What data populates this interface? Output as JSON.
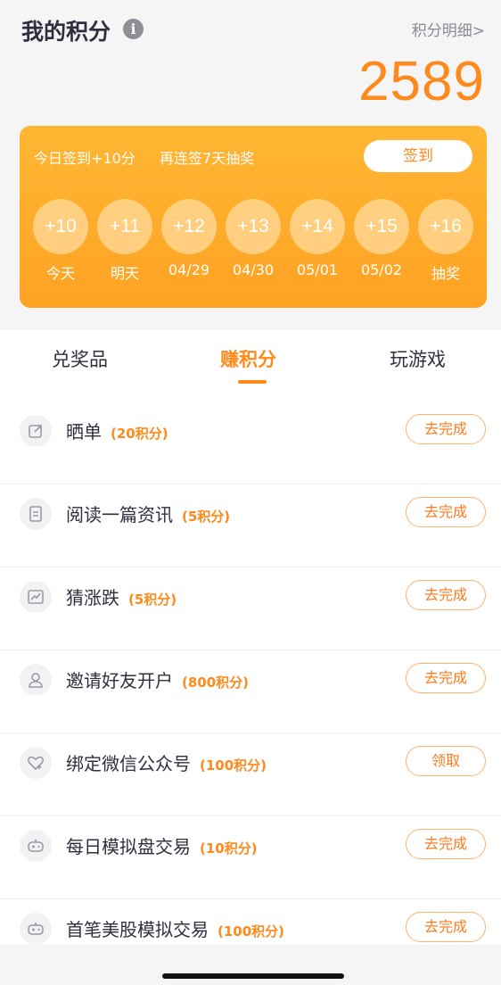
{
  "header": {
    "title": "我的积分",
    "detail_link": "积分明细>",
    "points": "2589"
  },
  "checkin": {
    "today_text": "今日签到+10分",
    "streak_text": "再连签7天抽奖",
    "button_label": "签到",
    "days": [
      {
        "bonus": "+10",
        "label": "今天"
      },
      {
        "bonus": "+11",
        "label": "明天"
      },
      {
        "bonus": "+12",
        "label": "04/29"
      },
      {
        "bonus": "+13",
        "label": "04/30"
      },
      {
        "bonus": "+14",
        "label": "05/01"
      },
      {
        "bonus": "+15",
        "label": "05/02"
      },
      {
        "bonus": "+16",
        "label": "抽奖"
      }
    ]
  },
  "tabs": [
    {
      "label": "兑奖品",
      "active": false
    },
    {
      "label": "赚积分",
      "active": true
    },
    {
      "label": "玩游戏",
      "active": false
    }
  ],
  "tasks": [
    {
      "icon": "share-icon",
      "title": "晒单",
      "points": "(20积分)",
      "button": "去完成"
    },
    {
      "icon": "document-icon",
      "title": "阅读一篇资讯",
      "points": "(5积分)",
      "button": "去完成"
    },
    {
      "icon": "chart-icon",
      "title": "猜涨跌",
      "points": "(5积分)",
      "button": "去完成"
    },
    {
      "icon": "user-icon",
      "title": "邀请好友开户",
      "points": "(800积分)",
      "button": "去完成"
    },
    {
      "icon": "heart-plus-icon",
      "title": "绑定微信公众号",
      "points": "(100积分)",
      "button": "领取"
    },
    {
      "icon": "gamepad-icon",
      "title": "每日模拟盘交易",
      "points": "(10积分)",
      "button": "去完成"
    },
    {
      "icon": "gamepad-icon",
      "title": "首笔美股模拟交易",
      "points": "(100积分)",
      "button": "去完成"
    }
  ],
  "colors": {
    "accent": "#ff8a1c",
    "card_top": "#ffb733",
    "card_bottom": "#ffa224"
  }
}
